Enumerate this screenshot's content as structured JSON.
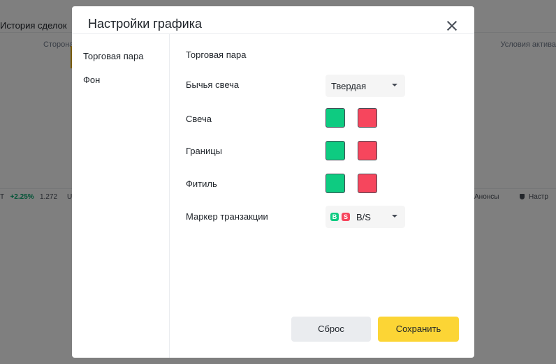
{
  "background": {
    "tab_history": "История сделок",
    "col_side": "Сторона",
    "col_conditions": "Условия актива",
    "ticker_prefix": "T",
    "ticker_change": "+2.25%",
    "ticker_price": "1.272",
    "ticker_next": "U",
    "announcements": "Анонсы",
    "settings": "Настр"
  },
  "modal": {
    "title": "Настройки графика",
    "sidebar": [
      "Торговая пара",
      "Фон"
    ],
    "section_title": "Торговая пара",
    "rows": {
      "bull_candle": {
        "label": "Бычья свеча",
        "value": "Твердая"
      },
      "candle": {
        "label": "Свеча"
      },
      "borders": {
        "label": "Границы"
      },
      "wick": {
        "label": "Фитиль"
      },
      "marker": {
        "label": "Маркер транзакции",
        "value": "B/S",
        "buy_letter": "B",
        "sell_letter": "S"
      }
    },
    "buttons": {
      "reset": "Сброс",
      "save": "Сохранить"
    }
  },
  "colors": {
    "up": "#0ecb81",
    "down": "#f6465d",
    "accent": "#fcd535"
  }
}
